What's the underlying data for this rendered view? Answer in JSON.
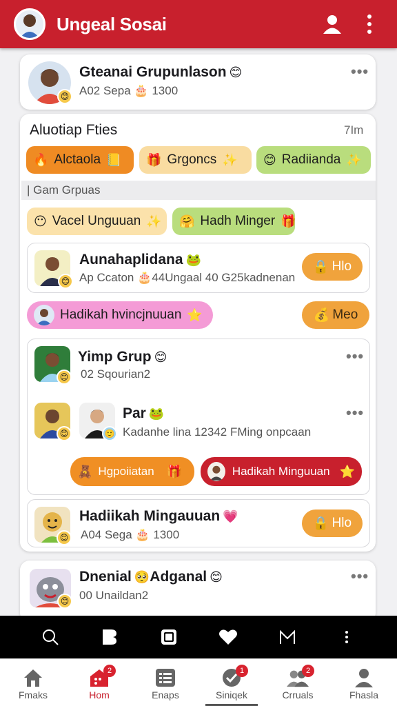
{
  "header": {
    "title": "Ungeal Sosai",
    "brand_color": "#c8202d",
    "icons": [
      "user-icon",
      "more-vertical-icon"
    ]
  },
  "top_post": {
    "name": "Gteanai Grupunlason",
    "name_emoji": "😊",
    "sub_pre": "A02 Sepa",
    "sub_emoji": "🎂",
    "sub_post": "1300",
    "menu": "•••"
  },
  "activity": {
    "title": "Aluotiap Fties",
    "time": "7Im",
    "tags": [
      {
        "icon": "🔥",
        "label": "Alctaola",
        "end": "📒"
      },
      {
        "icon": "🎁",
        "label": "Grgoncs",
        "end": "✨"
      },
      {
        "icon": "😊",
        "label": "Radiianda",
        "end": "✨"
      }
    ],
    "section_label": "Gam Grpuas",
    "group_tags": [
      {
        "icon": "😶",
        "label": "Vacel Unguuan",
        "end": "✨"
      },
      {
        "icon": "🤗",
        "label": "Hadh Minger",
        "end": "🎁"
      }
    ],
    "member1": {
      "name": "Aunahaplidana",
      "emoji": "🐸",
      "sub_pre": "Ap Ccaton",
      "sub_emoji": "🎂",
      "sub_post": "44Ungaal 40 G25kadnenan",
      "button": "Hlo",
      "button_icon": "🔒"
    },
    "pink_tag": {
      "label": "Hadikah hvincjnuuan",
      "end": "⭐"
    },
    "meo_button": {
      "label": "Meo",
      "icon": "💰"
    },
    "group_card": {
      "group_name": "Yimp Grup",
      "group_emoji": "😊",
      "group_sub": "02 Sqourian2",
      "menu1": "•••",
      "par_name": "Par",
      "par_emoji": "🐸",
      "par_sub": "Kadanhe lina 12342 FMing onpcaan",
      "menu2": "•••",
      "btn_orange": "Hgpoiiatan",
      "btn_orange_icon": "🧸",
      "btn_orange_end": "🎁",
      "btn_red": "Hadikah Minguuan",
      "btn_red_end": "⭐"
    },
    "member2": {
      "name": "Hadiikah Mingauuan",
      "emoji": "💗",
      "sub_pre": "A04 Sega",
      "sub_emoji": "🎂",
      "sub_post": "1300",
      "button": "Hlo",
      "button_icon": "🔒"
    }
  },
  "bottom_post": {
    "name_pre": "Dnenial",
    "name_emoji1": "🥺",
    "name_post": "Adganal",
    "name_emoji2": "😊",
    "sub": "00 Unaildan2",
    "menu": "•••"
  },
  "system_bar": {
    "icons": [
      "search-icon",
      "b-icon",
      "square-icon",
      "heart-icon",
      "m-icon",
      "more-vertical-icon"
    ]
  },
  "bottom_nav": {
    "items": [
      {
        "label": "Fmaks",
        "icon": "home-icon",
        "badge": ""
      },
      {
        "label": "Hom",
        "icon": "home-calendar-icon",
        "badge": "2"
      },
      {
        "label": "Enaps",
        "icon": "list-icon",
        "badge": ""
      },
      {
        "label": "Siniqek",
        "icon": "check-icon",
        "badge": "1"
      },
      {
        "label": "Crruals",
        "icon": "group-icon",
        "badge": "2"
      },
      {
        "label": "Fhasla",
        "icon": "person-icon",
        "badge": ""
      }
    ]
  }
}
